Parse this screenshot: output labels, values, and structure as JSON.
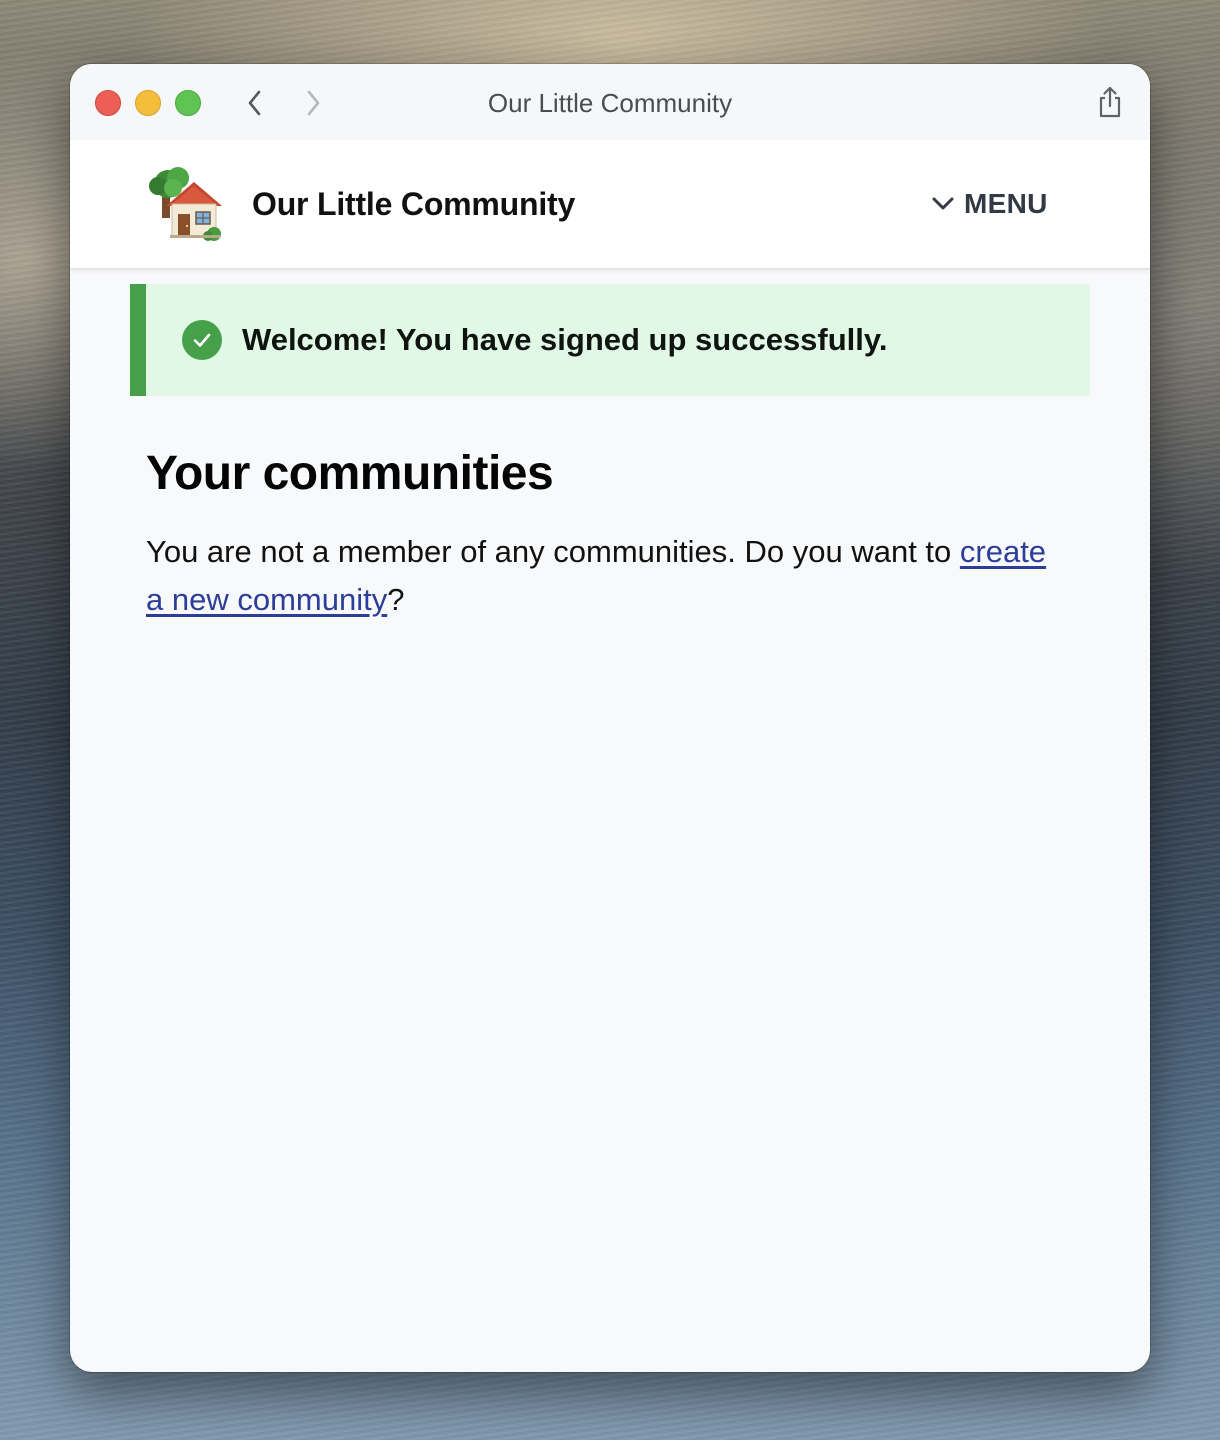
{
  "window": {
    "title": "Our Little Community"
  },
  "site": {
    "name": "Our Little Community",
    "logo_icon": "house-with-tree-icon",
    "menu_label": "MENU"
  },
  "flash": {
    "message": "Welcome! You have signed up successfully.",
    "icon": "check-circle-icon",
    "accent_color": "#45a049",
    "background_color": "#e1f8e6"
  },
  "main": {
    "title": "Your communities",
    "empty_text_before": "You are not a member of any communities. Do you want to ",
    "empty_link_text": "create a new community",
    "empty_text_after": "?"
  },
  "colors": {
    "link": "#2d3e9a",
    "traffic_close": "#ec5f57",
    "traffic_minimize": "#f4bd3c",
    "traffic_maximize": "#5fc453"
  }
}
